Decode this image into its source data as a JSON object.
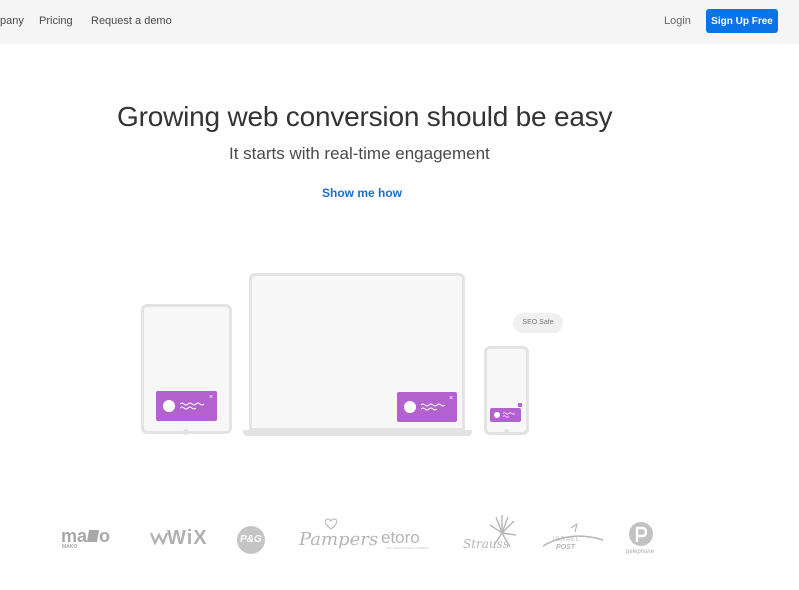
{
  "header": {
    "nav": [
      "pany",
      "Pricing",
      "Request a demo"
    ],
    "login": "Login",
    "signup": "Sign Up Free"
  },
  "hero": {
    "title": "Growing web conversion should be easy",
    "subtitle": "It starts with real-time engagement",
    "cta": "Show me how"
  },
  "illustration": {
    "badge": "SEO Safe",
    "popup_color": "#b461d0"
  },
  "logos": {
    "mako": "ma",
    "mako_o": "o",
    "mako_sub": "MAKO",
    "wix": "WiX",
    "pg": "P&G",
    "pampers": "Pampers",
    "etoro": "etoro",
    "etoro_sub": "Your Social Investment Network",
    "strauss": "Strauss",
    "israel_post_1": "ISRAEL",
    "israel_post_2": "POST",
    "pelephone": "pelephone"
  },
  "colors": {
    "accent": "#0a74e6",
    "link": "#1f6fc7",
    "logo_gray": "#b5b5b5"
  }
}
